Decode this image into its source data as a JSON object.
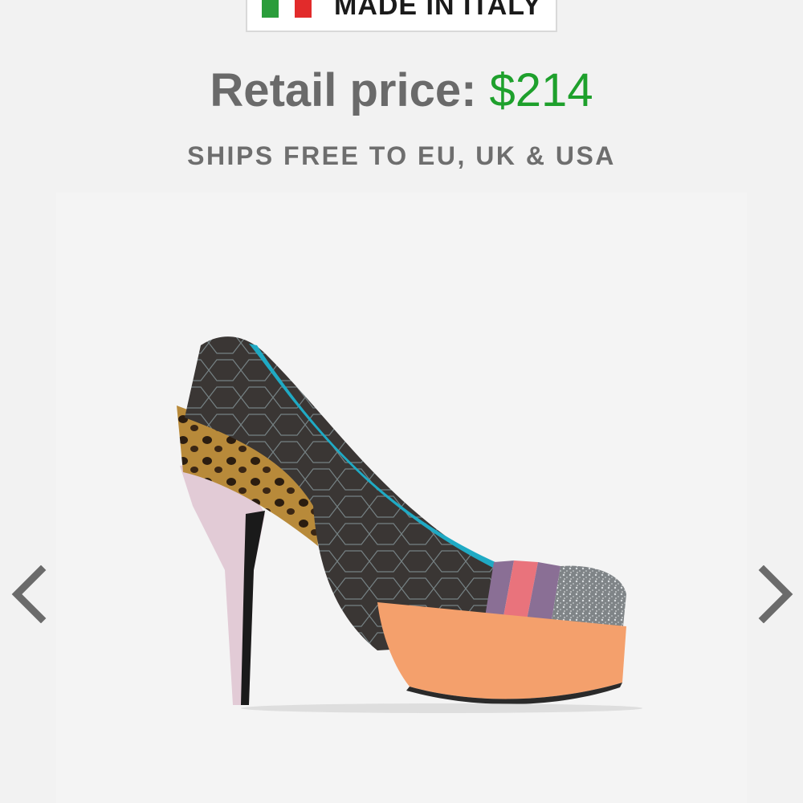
{
  "badge": {
    "text": "MADE IN ITALY",
    "flag_colors": [
      "#2a9d3a",
      "#ffffff",
      "#e22b2b"
    ]
  },
  "price": {
    "label": "Retail price:",
    "value": "$214",
    "label_color": "#6a6a6a",
    "value_color": "#1ea02c"
  },
  "shipping": {
    "text": "SHIPS FREE TO EU, UK & USA"
  },
  "carousel": {
    "prev_icon": "chevron-left-icon",
    "next_icon": "chevron-right-icon",
    "arrow_color": "#6b6b6b"
  },
  "product_image": {
    "icon": "high-heel-shoe-image"
  }
}
